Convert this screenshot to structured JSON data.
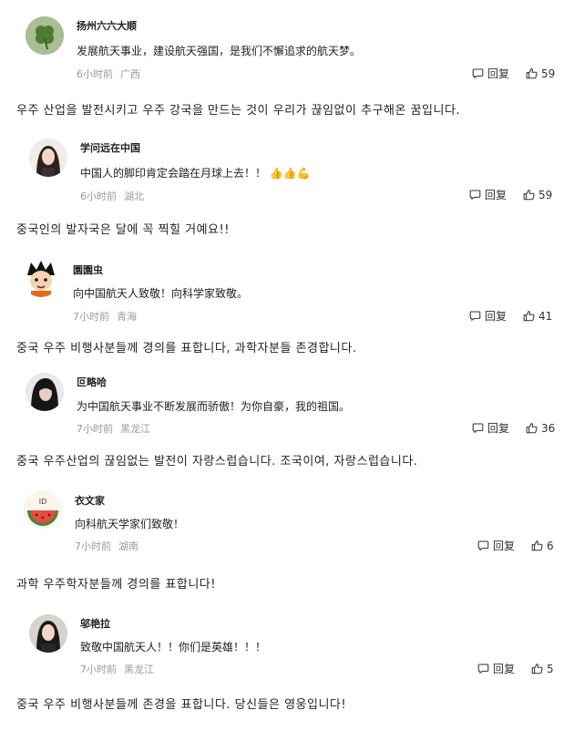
{
  "comments": [
    {
      "user": "扬州六六大顺",
      "text": "发展航天事业，建设航天强国，是我们不懈追求的航天梦。",
      "time": "6小时前",
      "location": "广西",
      "reply_label": "回复",
      "likes": "59",
      "avatar_icon": "clover-icon",
      "translation": "우주 산업을 발전시키고 우주 강국을 만드는 것이 우리가 끊임없이 추구해온 꿈입니다."
    },
    {
      "user": "学问远在中国",
      "text": "中国人的脚印肯定会踏在月球上去！！",
      "emoji": "👍👍💪",
      "time": "6小时前",
      "location": "湖北",
      "reply_label": "回复",
      "likes": "59",
      "avatar_icon": "woman-portrait-icon",
      "translation": "중국인의 발자국은 달에 꼭 찍힐 거예요!!"
    },
    {
      "user": "園園虫",
      "text": "向中国航天人致敬！向科学家致敬。",
      "time": "7小时前",
      "location": "青海",
      "reply_label": "回复",
      "likes": "41",
      "avatar_icon": "cartoon-boy-icon",
      "translation": "중국 우주 비행사분들께 경의를 표합니다, 과학자분들 존경합니다."
    },
    {
      "user": "叵略哈",
      "text": "为中国航天事业不断发展而骄傲！为你自豪，我的祖国。",
      "time": "7小时前",
      "location": "黑龙江",
      "reply_label": "回复",
      "likes": "36",
      "avatar_icon": "woman-dark-portrait-icon",
      "translation": "중국 우주산업의 끊임없는 발전이 자랑스럽습니다. 조국이여, 자랑스럽습니다."
    },
    {
      "user": "衣文家",
      "text": "向科航天学家们致敬！",
      "time": "7小时前",
      "location": "湖南",
      "reply_label": "回复",
      "likes": "6",
      "avatar_icon": "watermelon-icon",
      "translation": "과학 우주학자분들께 경의를 표합니다!"
    },
    {
      "user": "邬艳拉",
      "text": "致敬中国航天人！！你们是英雄！！！",
      "time": "7小时前",
      "location": "黑龙江",
      "reply_label": "回复",
      "likes": "5",
      "avatar_icon": "woman-portrait-icon",
      "translation": "중국 우주 비행사분들께 존경을 표합니다. 당신들은 영웅입니다!"
    }
  ]
}
